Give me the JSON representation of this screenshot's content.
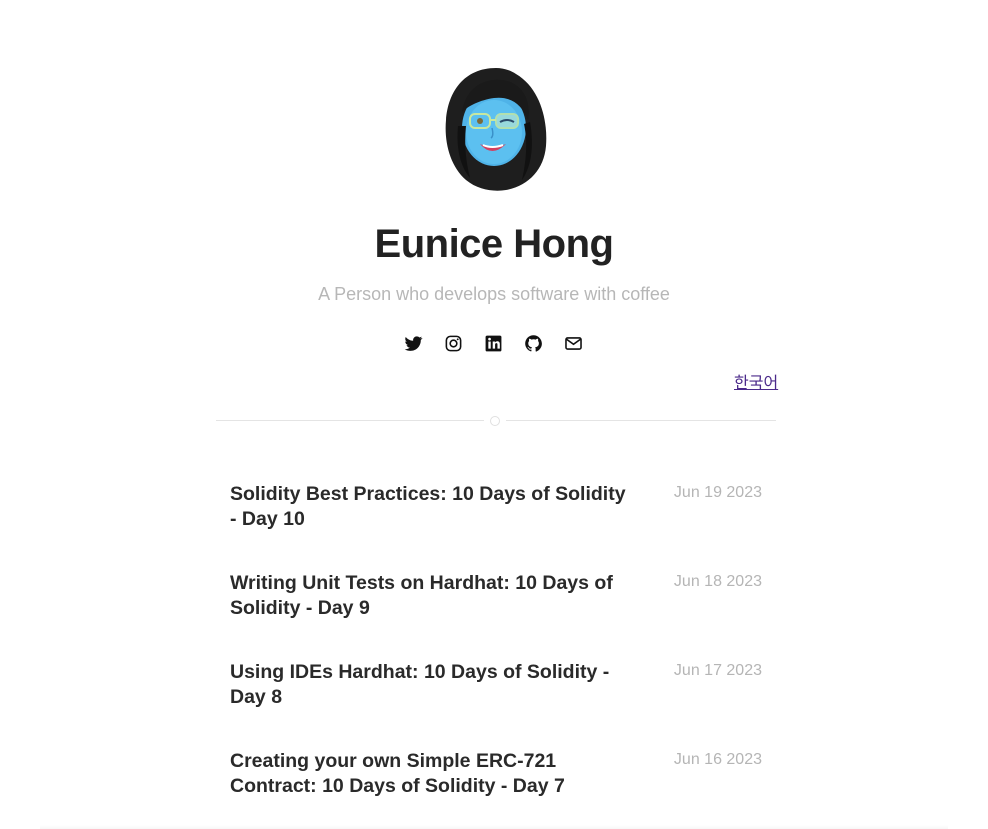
{
  "profile": {
    "name": "Eunice Hong",
    "tagline": "A Person who develops software with coffee"
  },
  "social": [
    {
      "icon": "twitter-icon"
    },
    {
      "icon": "instagram-icon"
    },
    {
      "icon": "linkedin-icon"
    },
    {
      "icon": "github-icon"
    },
    {
      "icon": "mail-icon"
    }
  ],
  "language_link": "한국어",
  "posts": [
    {
      "title": "Solidity Best Practices: 10 Days of Solidity - Day 10",
      "date": "Jun 19 2023"
    },
    {
      "title": "Writing Unit Tests on Hardhat: 10 Days of Solidity - Day 9",
      "date": "Jun 18 2023"
    },
    {
      "title": "Using IDEs Hardhat: 10 Days of Solidity - Day 8",
      "date": "Jun 17 2023"
    },
    {
      "title": "Creating your own Simple ERC-721 Contract: 10 Days of Solidity - Day 7",
      "date": "Jun 16 2023"
    }
  ],
  "colors": {
    "title": "#222222",
    "tagline": "#b7b7b7",
    "date": "#b5b5b5",
    "link": "#4b2a8a",
    "avatar_skin": "#4fb3e8"
  }
}
